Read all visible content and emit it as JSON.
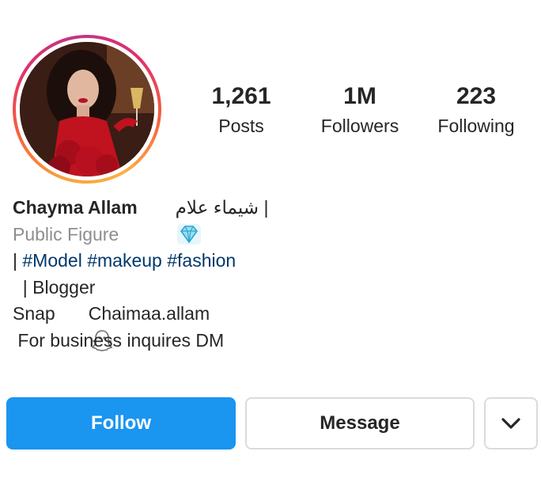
{
  "profile": {
    "avatar_icon": "profile-photo",
    "ring_colors": [
      "#f9a23c",
      "#e1306c",
      "#c13584"
    ]
  },
  "stats": [
    {
      "value": "1,261",
      "label": "Posts"
    },
    {
      "value": "1M",
      "label": "Followers"
    },
    {
      "value": "223",
      "label": "Following"
    }
  ],
  "bio": {
    "name": "Chayma Allam",
    "name_icon": "diamond-icon",
    "arabic_name": "| شيماء علام",
    "category": "Public Figure",
    "tags_prefix": "| ",
    "tags": [
      "#Model",
      "#makeup",
      "#fashion"
    ],
    "line_blogger": "  | Blogger",
    "snap_label": "Snap",
    "snap_icon": "snapchat-ghost-icon",
    "snap_handle": "Chaimaa.allam",
    "business_line": " For business inquires DM"
  },
  "actions": {
    "follow_label": "Follow",
    "message_label": "Message",
    "more_icon": "chevron-down-icon",
    "follow_color": "#1a95f0"
  }
}
